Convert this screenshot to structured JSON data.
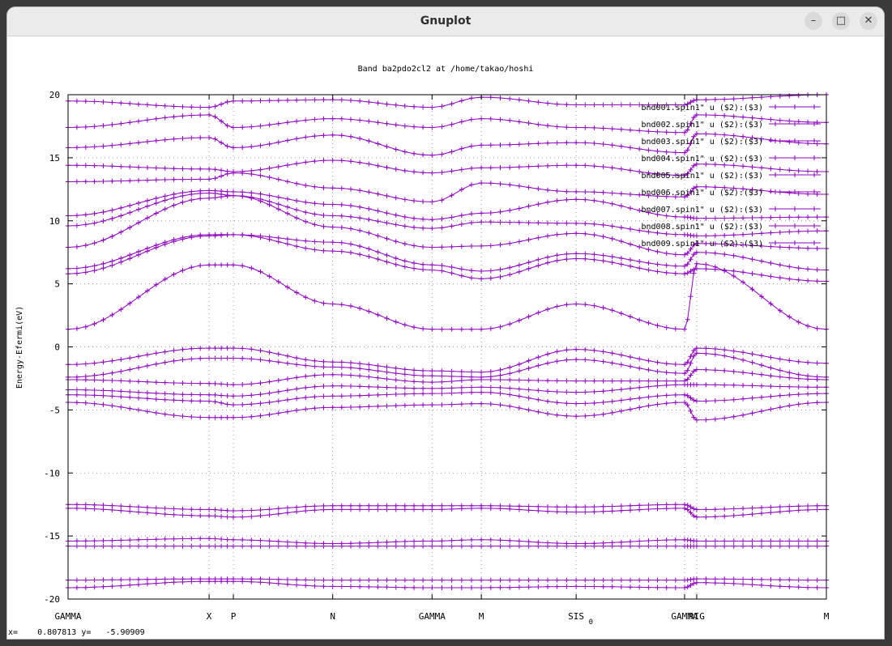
{
  "window": {
    "title": "Gnuplot",
    "buttons": {
      "minimize": "–",
      "maximize": "□",
      "close": "✕"
    }
  },
  "status": {
    "x_label": "x=",
    "x_value": "0.807813",
    "y_label": "y=",
    "y_value": "-5.90909"
  },
  "colors": {
    "series": "#8f00c0",
    "grid": "#9a9a9a",
    "axis": "#000000"
  },
  "chart_data": {
    "type": "line",
    "title": "Band ba2pdo2cl2 at /home/takao/hoshi",
    "ylabel": "Energy-Efermi(eV)",
    "xlabel": "",
    "ylim": [
      -20,
      20
    ],
    "xlim": [
      0,
      1
    ],
    "yticks": [
      20,
      15,
      10,
      5,
      0,
      -5,
      -10,
      -15,
      -20
    ],
    "xticks": [
      {
        "label": "GAMMA",
        "x": 0.0
      },
      {
        "label": "X",
        "x": 0.186
      },
      {
        "label": "P",
        "x": 0.218
      },
      {
        "label": "N",
        "x": 0.349
      },
      {
        "label": "GAMMA",
        "x": 0.48
      },
      {
        "label": "M",
        "x": 0.545
      },
      {
        "label": "SIS",
        "x": 0.67
      },
      {
        "label": "0",
        "x": 0.683,
        "sub": true
      },
      {
        "label": "GAMMA",
        "x": 0.813
      },
      {
        "label": "RIG",
        "x": 0.829
      },
      {
        "label": "M",
        "x": 1.0
      }
    ],
    "legend_position": "top-right",
    "legend": [
      "bnd001.spin1\" u ($2):($3)",
      "bnd002.spin1\" u ($2):($3)",
      "bnd003.spin1\" u ($2):($3)",
      "bnd004.spin1\" u ($2):($3)",
      "bnd005.spin1\" u ($2):($3)",
      "bnd006.spin1\" u ($2):($3)",
      "bnd007.spin1\" u ($2):($3)",
      "bnd008.spin1\" u ($2):($3)",
      "bnd009.spin1\" u ($2):($3)"
    ],
    "grid": true,
    "series": [
      {
        "x": [
          0,
          0.186,
          0.218,
          0.349,
          0.48,
          0.545,
          0.67,
          0.813,
          0.829,
          1.0
        ],
        "values": [
          1.4,
          6.5,
          6.5,
          3.4,
          1.4,
          1.4,
          3.4,
          1.4,
          6.6,
          1.4
        ]
      },
      {
        "x": [
          0,
          0.186,
          0.218,
          0.349,
          0.48,
          0.545,
          0.67,
          0.813,
          0.829,
          1.0
        ],
        "values": [
          5.8,
          8.8,
          8.9,
          7.6,
          6.1,
          5.4,
          7.0,
          5.8,
          6.2,
          5.2
        ]
      },
      {
        "x": [
          0,
          0.186,
          0.218,
          0.349,
          0.48,
          0.545,
          0.67,
          0.813,
          0.829,
          1.0
        ],
        "values": [
          6.2,
          8.9,
          8.9,
          8.3,
          6.5,
          6.0,
          7.4,
          6.4,
          7.5,
          6.1
        ]
      },
      {
        "x": [
          0,
          0.186,
          0.218,
          0.349,
          0.48,
          0.545,
          0.67,
          0.813,
          0.829,
          1.0
        ],
        "values": [
          7.9,
          11.8,
          12.0,
          9.5,
          7.9,
          8.0,
          9.0,
          7.3,
          8.2,
          7.8
        ]
      },
      {
        "x": [
          0,
          0.186,
          0.218,
          0.349,
          0.48,
          0.545,
          0.67,
          0.813,
          0.829,
          1.0
        ],
        "values": [
          9.6,
          12.2,
          12.0,
          10.4,
          9.4,
          9.9,
          9.8,
          8.9,
          8.8,
          9.2
        ]
      },
      {
        "x": [
          0,
          0.186,
          0.218,
          0.349,
          0.48,
          0.545,
          0.67,
          0.813,
          0.829,
          1.0
        ],
        "values": [
          10.4,
          12.4,
          12.3,
          11.3,
          10.1,
          10.6,
          11.7,
          10.3,
          10.2,
          10.3
        ]
      },
      {
        "x": [
          0,
          0.186,
          0.218,
          0.349,
          0.48,
          0.545,
          0.67,
          0.813,
          0.829,
          1.0
        ],
        "values": [
          13.1,
          13.3,
          13.8,
          12.6,
          11.5,
          13.0,
          12.3,
          11.9,
          12.7,
          12.1
        ]
      },
      {
        "x": [
          0,
          0.186,
          0.218,
          0.349,
          0.48,
          0.545,
          0.67,
          0.813,
          0.829,
          1.0
        ],
        "values": [
          14.4,
          14.1,
          13.9,
          14.8,
          13.8,
          14.2,
          14.4,
          13.6,
          14.5,
          13.9
        ]
      },
      {
        "x": [
          0,
          0.186,
          0.218,
          0.349,
          0.48,
          0.545,
          0.67,
          0.813,
          0.829,
          1.0
        ],
        "values": [
          15.8,
          16.6,
          15.8,
          16.8,
          15.2,
          16.0,
          16.2,
          15.4,
          16.9,
          16.1
        ]
      },
      {
        "x": [
          0,
          0.186,
          0.218,
          0.349,
          0.48,
          0.545,
          0.67,
          0.813,
          0.829,
          1.0
        ],
        "values": [
          17.4,
          18.4,
          17.4,
          18.1,
          17.4,
          18.1,
          17.4,
          17.0,
          18.4,
          17.8
        ]
      },
      {
        "x": [
          0,
          0.186,
          0.218,
          0.349,
          0.48,
          0.545,
          0.67,
          0.813,
          0.829,
          1.0
        ],
        "values": [
          19.5,
          19.0,
          19.5,
          19.6,
          19.0,
          19.8,
          19.2,
          19.2,
          19.6,
          20.0
        ]
      },
      {
        "x": [
          0,
          0.186,
          0.218,
          0.349,
          0.48,
          0.545,
          0.67,
          0.813,
          0.829,
          1.0
        ],
        "values": [
          -1.4,
          -0.1,
          -0.1,
          -1.2,
          -1.9,
          -2.0,
          -0.2,
          -1.4,
          -0.1,
          -1.3
        ]
      },
      {
        "x": [
          0,
          0.186,
          0.218,
          0.349,
          0.48,
          0.545,
          0.67,
          0.813,
          0.829,
          1.0
        ],
        "values": [
          -2.4,
          -0.9,
          -0.9,
          -1.6,
          -2.3,
          -2.4,
          -1.0,
          -2.1,
          -0.5,
          -2.4
        ]
      },
      {
        "x": [
          0,
          0.186,
          0.218,
          0.349,
          0.48,
          0.545,
          0.67,
          0.813,
          0.829,
          1.0
        ],
        "values": [
          -2.6,
          -2.9,
          -3.0,
          -2.2,
          -2.8,
          -2.6,
          -2.7,
          -2.7,
          -1.8,
          -2.6
        ]
      },
      {
        "x": [
          0,
          0.186,
          0.218,
          0.349,
          0.48,
          0.545,
          0.67,
          0.813,
          0.829,
          1.0
        ],
        "values": [
          -3.4,
          -3.8,
          -3.9,
          -3.1,
          -3.3,
          -3.2,
          -3.6,
          -3.0,
          -3.0,
          -3.2
        ]
      },
      {
        "x": [
          0,
          0.186,
          0.218,
          0.349,
          0.48,
          0.545,
          0.67,
          0.813,
          0.829,
          1.0
        ],
        "values": [
          -3.8,
          -4.3,
          -4.6,
          -3.9,
          -3.7,
          -3.6,
          -4.5,
          -3.8,
          -4.3,
          -3.7
        ]
      },
      {
        "x": [
          0,
          0.186,
          0.218,
          0.349,
          0.48,
          0.545,
          0.67,
          0.813,
          0.829,
          1.0
        ],
        "values": [
          -4.4,
          -5.6,
          -5.6,
          -4.8,
          -4.6,
          -4.5,
          -5.5,
          -4.4,
          -5.8,
          -4.4
        ]
      },
      {
        "x": [
          0,
          0.186,
          0.218,
          0.349,
          0.48,
          0.545,
          0.67,
          0.813,
          0.829,
          1.0
        ],
        "values": [
          -12.5,
          -12.9,
          -13.0,
          -12.6,
          -12.6,
          -12.6,
          -12.7,
          -12.5,
          -12.9,
          -12.6
        ]
      },
      {
        "x": [
          0,
          0.186,
          0.218,
          0.349,
          0.48,
          0.545,
          0.67,
          0.813,
          0.829,
          1.0
        ],
        "values": [
          -12.8,
          -13.4,
          -13.5,
          -12.9,
          -12.9,
          -12.8,
          -13.1,
          -12.8,
          -13.5,
          -12.9
        ]
      },
      {
        "x": [
          0,
          0.186,
          0.218,
          0.349,
          0.48,
          0.545,
          0.67,
          0.813,
          0.829,
          1.0
        ],
        "values": [
          -15.4,
          -15.2,
          -15.3,
          -15.6,
          -15.4,
          -15.3,
          -15.6,
          -15.3,
          -15.4,
          -15.4
        ]
      },
      {
        "x": [
          0,
          0.186,
          0.218,
          0.349,
          0.48,
          0.545,
          0.67,
          0.813,
          0.829,
          1.0
        ],
        "values": [
          -15.8,
          -15.8,
          -15.8,
          -15.8,
          -15.8,
          -15.8,
          -15.8,
          -15.8,
          -15.8,
          -15.8
        ]
      },
      {
        "x": [
          0,
          0.186,
          0.218,
          0.349,
          0.48,
          0.545,
          0.67,
          0.813,
          0.829,
          1.0
        ],
        "values": [
          -18.5,
          -18.4,
          -18.4,
          -18.5,
          -18.5,
          -18.5,
          -18.5,
          -18.5,
          -18.4,
          -18.5
        ]
      },
      {
        "x": [
          0,
          0.186,
          0.218,
          0.349,
          0.48,
          0.545,
          0.67,
          0.813,
          0.829,
          1.0
        ],
        "values": [
          -19.1,
          -18.6,
          -18.6,
          -19.0,
          -19.1,
          -19.1,
          -19.0,
          -19.1,
          -18.7,
          -19.1
        ]
      }
    ]
  }
}
